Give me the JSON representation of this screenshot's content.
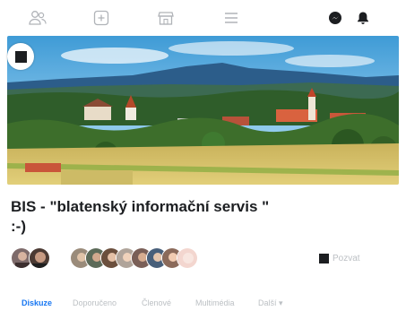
{
  "group": {
    "title": "BIS - \"blatenský informační servis \" :-)"
  },
  "members": {
    "invite_label": "Pozvat"
  },
  "tabs": [
    {
      "label": "Diskuze",
      "active": true
    },
    {
      "label": "Doporučeno",
      "active": false
    },
    {
      "label": "Členové",
      "active": false
    },
    {
      "label": "Multimédia",
      "active": false
    },
    {
      "label": "Další ▾",
      "active": false
    }
  ],
  "icons": {
    "nav": [
      "people-icon",
      "plus-box-icon",
      "store-icon",
      "menu-icon",
      "messenger-icon",
      "bell-icon"
    ]
  },
  "colors": {
    "accent": "#1877f2",
    "muted": "#bcc0c4",
    "text": "#1c1e21"
  }
}
